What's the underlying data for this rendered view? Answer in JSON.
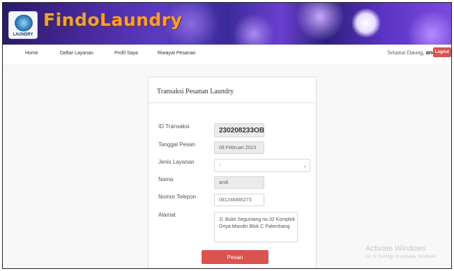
{
  "header": {
    "brand_word1": "Findo",
    "brand_word2": "Laundry",
    "logo_text": "LAUNDRY"
  },
  "nav": {
    "items": [
      {
        "label": "Home"
      },
      {
        "label": "Daftar Layanan"
      },
      {
        "label": "Profil Saya"
      },
      {
        "label": "Riwayat Pesanan"
      }
    ],
    "welcome_prefix": "Selamat Datang,",
    "username": "andi",
    "logout_label": "Logout"
  },
  "form": {
    "title": "Transaksi Pesanan Laundry",
    "fields": {
      "id_transaksi": {
        "label": "ID Transaksi",
        "value": "230208233OB"
      },
      "tanggal_pesan": {
        "label": "Tanggal Pesan",
        "value": "08 Februari 2023"
      },
      "jenis_layanan": {
        "label": "Jenis Layanan",
        "value": "-"
      },
      "nama": {
        "label": "Nama",
        "value": "andi"
      },
      "nomor_telepon": {
        "label": "Nomor Telepon",
        "value": "081248466273"
      },
      "alamat": {
        "label": "Alamat",
        "value": "Jl. Bukit Seguntang no.32 Komplek\nGriya Mandiri Blok C Palembang"
      }
    },
    "submit_label": "Pesan"
  },
  "watermark": {
    "line1": "Activate Windows",
    "line2": "Go to Settings to activate Windows."
  },
  "colors": {
    "banner": "#4a2aa0",
    "brand": "#e8a43a",
    "accent_red": "#d9534f"
  }
}
